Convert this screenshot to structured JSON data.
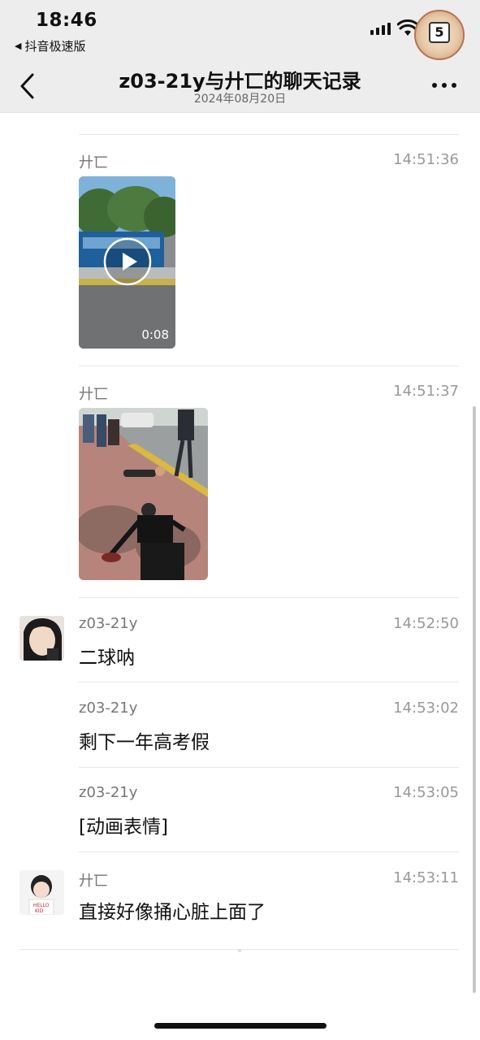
{
  "status_bar": {
    "time": "18:46",
    "back_app": "抖音极速版",
    "back_icon": "back-triangle-icon",
    "badge_text": "5"
  },
  "nav": {
    "title": "z03-21y与廾匸的聊天记录",
    "date": "2024年08月20日",
    "back_icon": "chevron-left-icon",
    "more_icon": "more-dots-icon"
  },
  "messages": [
    {
      "sender": "廾匸",
      "time": "14:51:36",
      "type": "video",
      "duration": "0:08"
    },
    {
      "sender": "廾匸",
      "time": "14:51:37",
      "type": "image"
    },
    {
      "sender": "z03-21y",
      "time": "14:52:50",
      "text": "二球呐"
    },
    {
      "sender": "z03-21y",
      "time": "14:53:02",
      "text": "剩下一年高考假"
    },
    {
      "sender": "z03-21y",
      "time": "14:53:05",
      "text": "[动画表情]"
    },
    {
      "sender": "廾匸",
      "time": "14:53:11",
      "text": "直接好像捅心脏上面了"
    }
  ],
  "colors": {
    "header_bg": "#ededed",
    "divider": "#e6e6e6",
    "timestamp": "#999999",
    "sender": "#777777"
  }
}
